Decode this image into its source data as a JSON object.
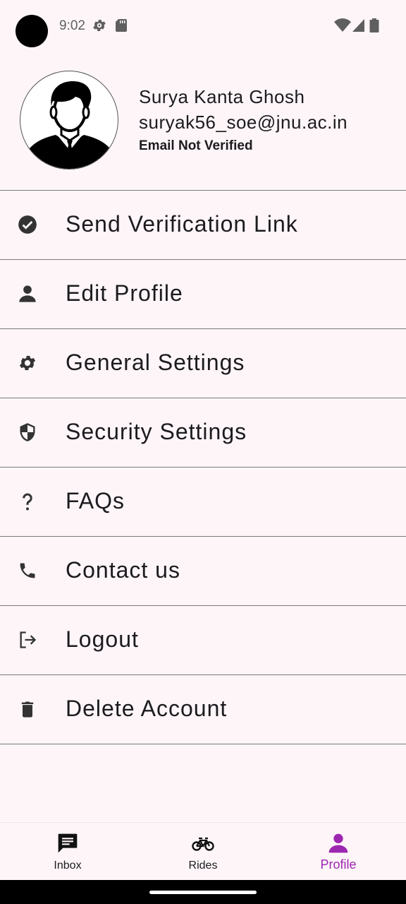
{
  "status_bar": {
    "time": "9:02"
  },
  "profile": {
    "name": "Surya Kanta Ghosh",
    "email": "suryak56_soe@jnu.ac.in",
    "verification_status": "Email Not Verified"
  },
  "menu": {
    "items": [
      {
        "label": "Send Verification Link",
        "icon": "check-circle-icon"
      },
      {
        "label": "Edit Profile",
        "icon": "person-icon"
      },
      {
        "label": "General Settings",
        "icon": "gear-icon"
      },
      {
        "label": "Security Settings",
        "icon": "shield-icon"
      },
      {
        "label": "FAQs",
        "icon": "question-icon"
      },
      {
        "label": "Contact us",
        "icon": "phone-icon"
      },
      {
        "label": "Logout",
        "icon": "logout-icon"
      },
      {
        "label": "Delete Account",
        "icon": "trash-icon"
      }
    ]
  },
  "bottom_nav": {
    "active": "Profile",
    "active_color": "#9c27b0",
    "items": [
      {
        "label": "Inbox",
        "icon": "chat-icon"
      },
      {
        "label": "Rides",
        "icon": "bicycle-icon"
      },
      {
        "label": "Profile",
        "icon": "person-icon"
      }
    ]
  }
}
